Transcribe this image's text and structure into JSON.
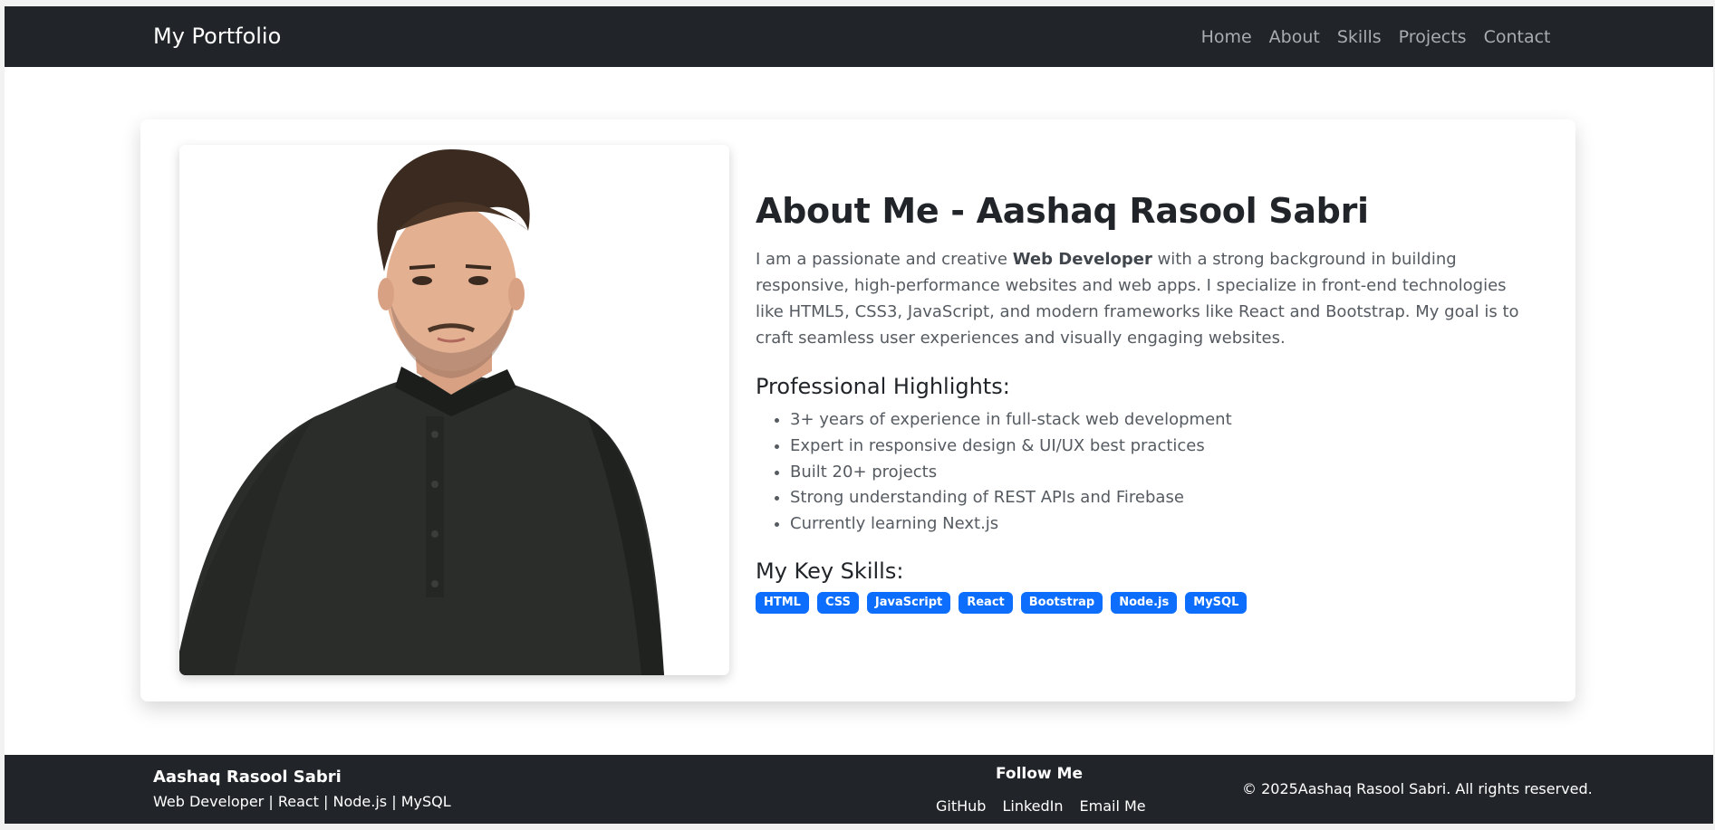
{
  "navbar": {
    "brand": "My Portfolio",
    "links": [
      "Home",
      "About",
      "Skills",
      "Projects",
      "Contact"
    ]
  },
  "about": {
    "title": "About Me - Aashaq Rasool Sabri",
    "intro_before": "I am a passionate and creative ",
    "intro_bold": "Web Developer",
    "intro_after": " with a strong background in building responsive, high-performance websites and web apps. I specialize in front-end technologies like HTML5, CSS3, JavaScript, and modern frameworks like React and Bootstrap. My goal is to craft seamless user experiences and visually engaging websites.",
    "highlights_title": "Professional Highlights:",
    "highlights": [
      "3+ years of experience in full-stack web development",
      "Expert in responsive design & UI/UX best practices",
      "Built 20+ projects",
      "Strong understanding of REST APIs and Firebase",
      "Currently learning Next.js"
    ],
    "skills_title": "My Key Skills:",
    "skills": [
      "HTML",
      "CSS",
      "JavaScript",
      "React",
      "Bootstrap",
      "Node.js",
      "MySQL"
    ],
    "badge_color": "#0d6efd"
  },
  "footer": {
    "name": "Aashaq Rasool Sabri",
    "subtitle": "Web Developer | React | Node.js | MySQL",
    "follow_title": "Follow Me",
    "follow_links": [
      "GitHub",
      "LinkedIn",
      "Email Me"
    ],
    "copyright": "© 2025Aashaq Rasool Sabri. All rights reserved."
  },
  "colors": {
    "dark": "#212529",
    "nav_link": "#a9acb0",
    "text_muted": "#555b61"
  }
}
